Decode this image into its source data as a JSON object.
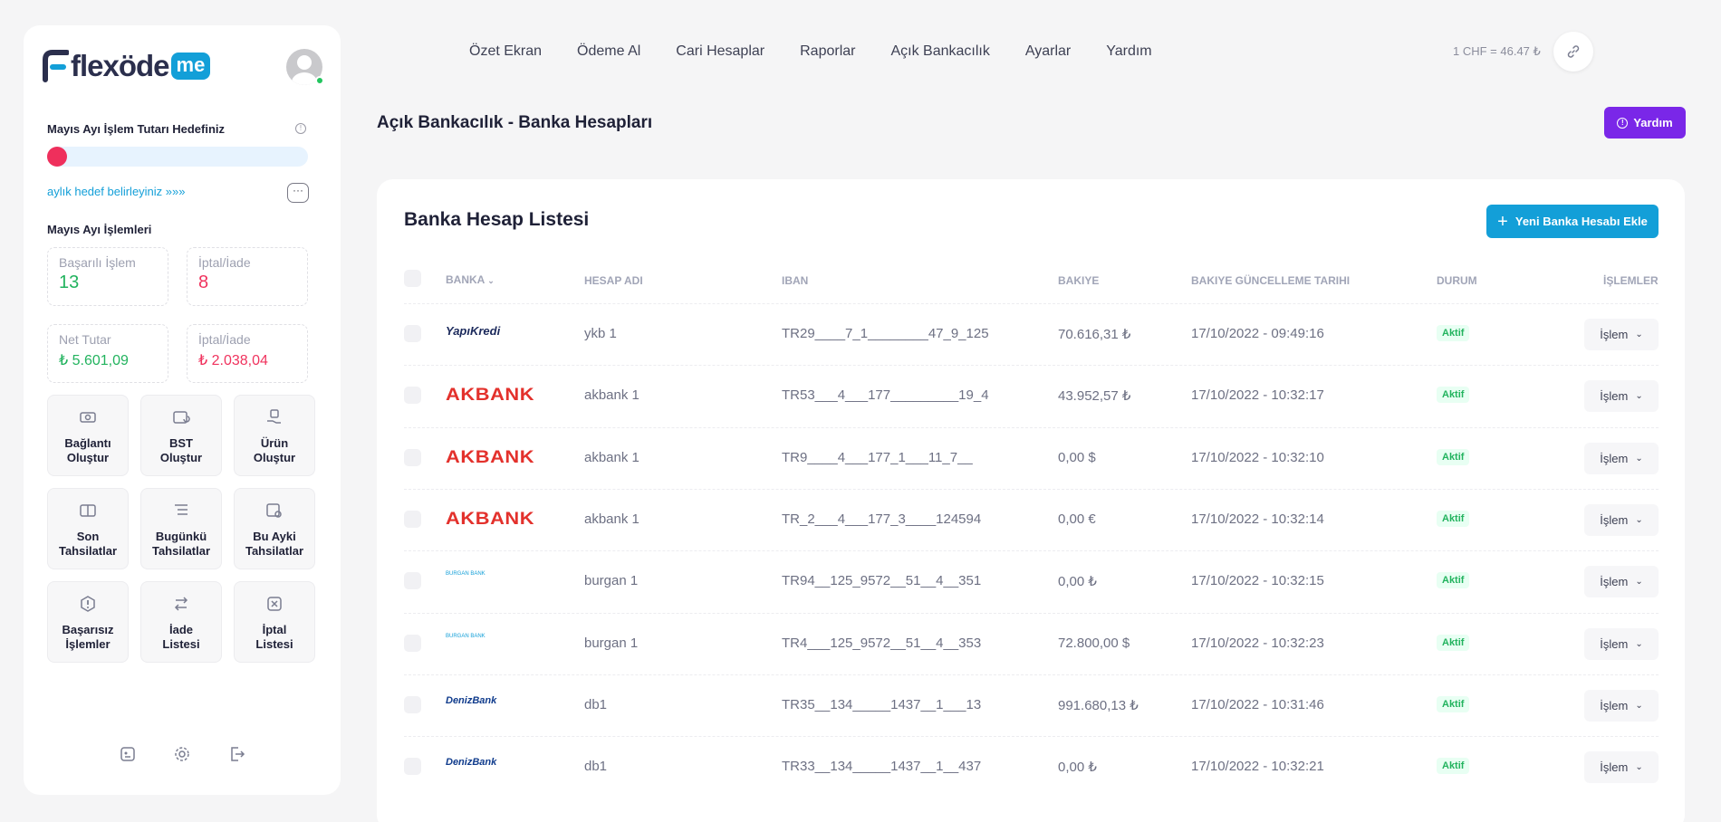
{
  "brand": {
    "logo_text": "flexöde",
    "logo_suffix": "me"
  },
  "sidebar": {
    "goal_title": "Mayıs Ayı İşlem Tutarı Hedefiniz",
    "goal_link": "aylık hedef belirleyiniz »»»",
    "goal_progress_percent": 0,
    "transactions_title": "Mayıs Ayı İşlemleri",
    "stats": {
      "success_label": "Başarılı İşlem",
      "success_value": "13",
      "refund_label": "İptal/İade",
      "refund_value": "8",
      "net_label": "Net Tutar",
      "net_value": "₺ 5.601,09",
      "refund_amount_label": "İptal/İade",
      "refund_amount_value": "₺ 2.038,04"
    },
    "tiles": [
      {
        "line1": "Bağlantı",
        "line2": "Oluştur",
        "icon": "money-icon"
      },
      {
        "line1": "BST",
        "line2": "Oluştur",
        "icon": "card-refresh-icon"
      },
      {
        "line1": "Ürün",
        "line2": "Oluştur",
        "icon": "product-hand-icon"
      },
      {
        "line1": "Son",
        "line2": "Tahsilatlar",
        "icon": "cards-icon"
      },
      {
        "line1": "Bugünkü",
        "line2": "Tahsilatlar",
        "icon": "list-icon"
      },
      {
        "line1": "Bu Ayki",
        "line2": "Tahsilatlar",
        "icon": "calendar-search-icon"
      },
      {
        "line1": "Başarısız",
        "line2": "İşlemler",
        "icon": "warning-icon"
      },
      {
        "line1": "İade",
        "line2": "Listesi",
        "icon": "swap-icon"
      },
      {
        "line1": "İptal",
        "line2": "Listesi",
        "icon": "cancel-icon"
      }
    ]
  },
  "nav": {
    "items": [
      "Özet Ekran",
      "Ödeme Al",
      "Cari Hesaplar",
      "Raporlar",
      "Açık Bankacılık",
      "Ayarlar",
      "Yardım"
    ],
    "rate": "1 CHF = 46.47 ₺"
  },
  "page": {
    "title": "Açık Bankacılık - Banka Hesapları",
    "help_label": "Yardım"
  },
  "card": {
    "title": "Banka Hesap Listesi",
    "add_label": "Yeni Banka Hesabı Ekle",
    "columns": [
      "BANKA",
      "HESAP ADI",
      "IBAN",
      "BAKIYE",
      "BAKIYE GÜNCELLEME TARIHI",
      "DURUM",
      "İŞLEMLER"
    ],
    "rows": [
      {
        "bank": "YapıKredi",
        "name": "ykb 1",
        "iban": "TR29____7_1________47_9_125",
        "balance": "70.616,31 ₺",
        "date": "17/10/2022 - 09:49:16",
        "status": "Aktif",
        "action": "İşlem"
      },
      {
        "bank": "AKBANK",
        "name": "akbank 1",
        "iban": "TR53___4___177_________19_4",
        "balance": "43.952,57 ₺",
        "date": "17/10/2022 - 10:32:17",
        "status": "Aktif",
        "action": "İşlem"
      },
      {
        "bank": "AKBANK",
        "name": "akbank 1",
        "iban": "TR9____4___177_1___11_7__",
        "balance": "0,00 $",
        "date": "17/10/2022 - 10:32:10",
        "status": "Aktif",
        "action": "İşlem"
      },
      {
        "bank": "AKBANK",
        "name": "akbank 1",
        "iban": "TR_2___4___177_3____124594",
        "balance": "0,00 €",
        "date": "17/10/2022 - 10:32:14",
        "status": "Aktif",
        "action": "İşlem"
      },
      {
        "bank": "BURGAN BANK",
        "name": "burgan 1",
        "iban": "TR94__125_9572__51__4__351",
        "balance": "0,00 ₺",
        "date": "17/10/2022 - 10:32:15",
        "status": "Aktif",
        "action": "İşlem"
      },
      {
        "bank": "BURGAN BANK",
        "name": "burgan 1",
        "iban": "TR4___125_9572__51__4__353",
        "balance": "72.800,00 $",
        "date": "17/10/2022 - 10:32:23",
        "status": "Aktif",
        "action": "İşlem"
      },
      {
        "bank": "DenizBank",
        "name": "db1",
        "iban": "TR35__134_____1437__1___13",
        "balance": "991.680,13 ₺",
        "date": "17/10/2022 - 10:31:46",
        "status": "Aktif",
        "action": "İşlem"
      },
      {
        "bank": "DenizBank",
        "name": "db1",
        "iban": "TR33__134_____1437__1__437",
        "balance": "0,00 ₺",
        "date": "17/10/2022 - 10:32:21",
        "status": "Aktif",
        "action": "İşlem"
      }
    ]
  },
  "colors": {
    "primary": "#139fd8",
    "help": "#7a27e8",
    "danger": "#f0335e",
    "success": "#22b35e"
  }
}
